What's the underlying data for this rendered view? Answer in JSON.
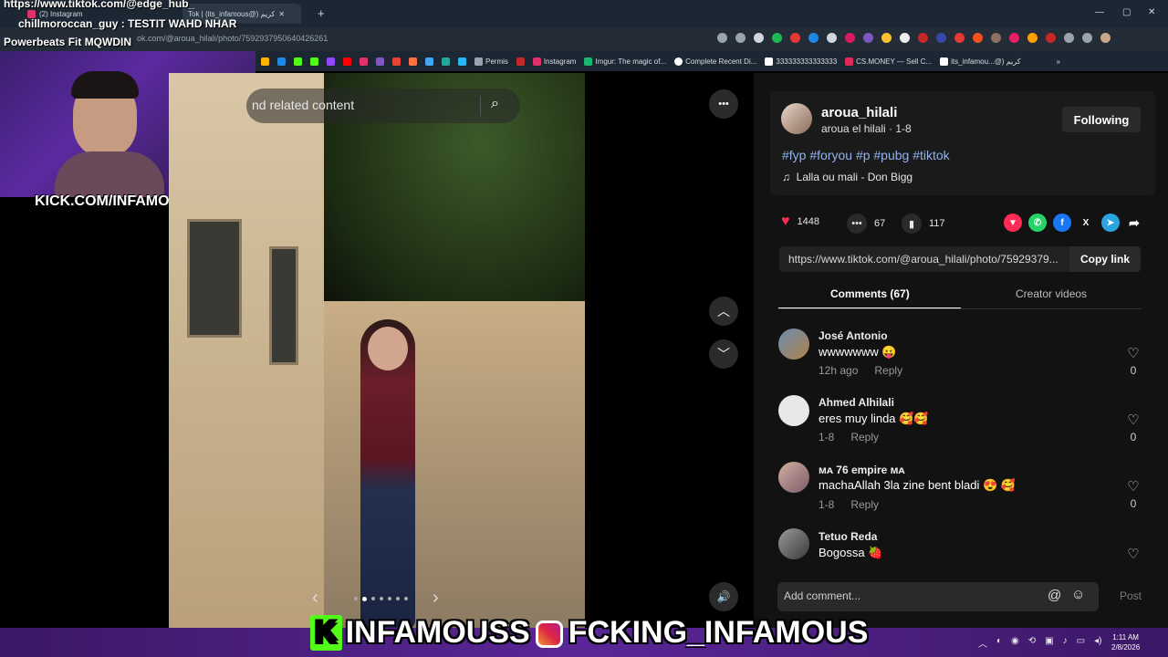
{
  "overlay": {
    "line1": "https://www.tiktok.com/@edge_hub_",
    "line2": "chillmoroccan_guy : TESTIT WAHD NHAR",
    "line3": "Powerbeats Fit MQWDIN",
    "kick_label": "KICK.COM/INFAMOUSS",
    "banner_name": "INFAMOUSS",
    "banner_ig": "FCKING_INFAMOUS"
  },
  "browser": {
    "tabs": [
      {
        "label": "(2) Instagram"
      },
      {
        "label": "Tok | (its_infamous@) كريم"
      }
    ],
    "new_tab": "+",
    "url": "https://www.tiktok.com/@aroua_hilali/photo/7592937950640426261",
    "url_visible": "ok.com/@aroua_hilali/photo/7592937950640426261",
    "window_controls": [
      "—",
      "▢",
      "✕"
    ],
    "bookmarks": [
      {
        "label": "Permis",
        "color": "#8a8a8a"
      },
      {
        "label": "Instagram",
        "color": "#e1306c"
      },
      {
        "label": "Imgur: The magic of...",
        "color": "#1bb76e"
      },
      {
        "label": "Complete Recent Di...",
        "color": "#ffffff"
      },
      {
        "label": "333333333333333",
        "color": "#ffffff"
      },
      {
        "label": "CS.MONEY — Sell C...",
        "color": "#e0285a"
      },
      {
        "label": "its_infamou...@) كريم",
        "color": "#ffffff"
      }
    ]
  },
  "photo": {
    "search_placeholder": "nd related content",
    "more": "•••",
    "up": "︿",
    "down": "﹀",
    "prev": "‹",
    "next": "›",
    "volume": "🔊"
  },
  "author": {
    "username": "aroua_hilali",
    "subline": "aroua el hilali · 1-8",
    "follow_label": "Following",
    "hashtags": "#fyp #foryou #p #pubg #tiktok",
    "music": "Lalla ou mali - Don Bigg"
  },
  "stats": {
    "likes": "1448",
    "comments": "67",
    "saves": "117"
  },
  "share_link": {
    "url": "https://www.tiktok.com/@aroua_hilali/photo/75929379...",
    "copy_label": "Copy link"
  },
  "tabs": {
    "comments": "Comments (67)",
    "creator": "Creator videos"
  },
  "comments": [
    {
      "name": "José Antonio",
      "text": "wwwwwww 😛",
      "time": "12h ago",
      "reply": "Reply",
      "likes": "0"
    },
    {
      "name": "Ahmed Alhilali",
      "text": "eres muy linda 🥰🥰",
      "time": "1-8",
      "reply": "Reply",
      "likes": "0"
    },
    {
      "name": "ᴍᴀ 76 empire ᴍᴀ",
      "text": "machaAllah 3la zine bent bladi 😍 🥰",
      "time": "1-8",
      "reply": "Reply",
      "likes": "0"
    },
    {
      "name": "Tetuo Reda",
      "text": "Bogossa 🍓",
      "time": "",
      "reply": "",
      "likes": ""
    }
  ],
  "add_comment": {
    "placeholder": "Add comment...",
    "post": "Post"
  },
  "clock": {
    "time": "1:11 AM",
    "date": "2/8/2026"
  }
}
